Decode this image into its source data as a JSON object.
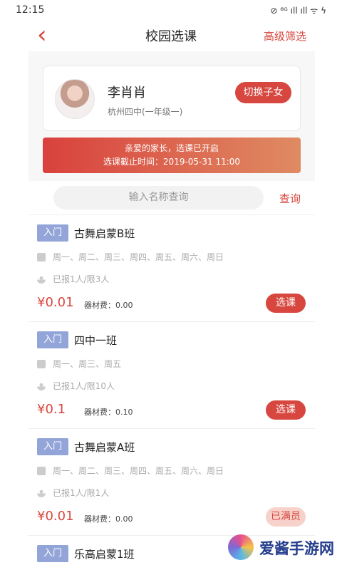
{
  "status": {
    "time": "12:15",
    "icons": "⊘ ⁶ᴳ ıll ıll ᯤ ϟ"
  },
  "header": {
    "back_icon": "‹",
    "title": "校园选课",
    "filter": "高级筛选"
  },
  "profile": {
    "name": "李肖肖",
    "school": "杭州四中(一年级一)",
    "switch": "切换子女"
  },
  "notice": {
    "line1": "亲爱的家长，选课已开启",
    "line2": "选课截止时间：2019-05-31 11:00"
  },
  "search": {
    "placeholder": "输入名称查询",
    "button": "查询"
  },
  "courses": [
    {
      "tag": "入门",
      "title": "古舞启蒙B班",
      "days": "周一、周二、周三、周四、周五、周六、周日",
      "count": "已报1人/限3人",
      "price": "¥0.01",
      "fee": "器材费：0.00",
      "action": "选课"
    },
    {
      "tag": "入门",
      "title": "四中一班",
      "days": "周一、周三、周五",
      "count": "已报1人/限10人",
      "price": "¥0.1",
      "fee": "器材费：0.10",
      "action": "选课"
    },
    {
      "tag": "入门",
      "title": "古舞启蒙A班",
      "days": "周一、周二、周三、周四、周五、周六、周日",
      "count": "已报1人/限1人",
      "price": "¥0.01",
      "fee": "器材费：0.00",
      "action": "已满员"
    },
    {
      "tag": "入门",
      "title": "乐高启蒙1班"
    }
  ],
  "watermark": {
    "text": "爱酱手游网"
  },
  "colors": {
    "accent": "#d7473f",
    "tag": "#93a4d9"
  }
}
